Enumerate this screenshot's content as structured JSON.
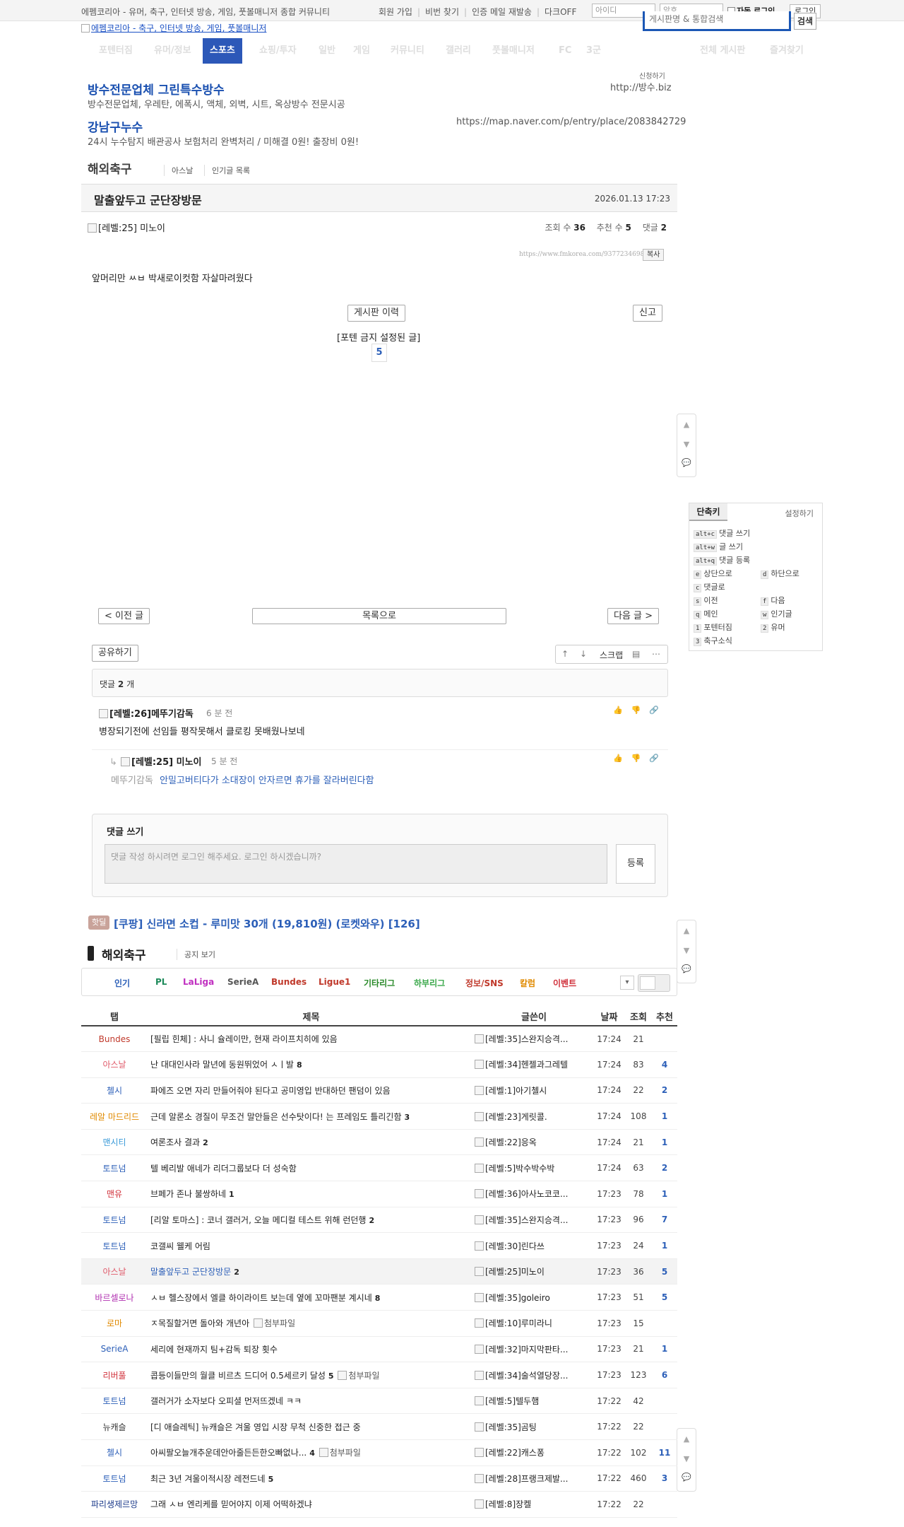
{
  "topbar": {
    "tagline": "에펨코리아 - 유머, 축구, 인터넷 방송, 게임, 풋볼매니저 종합 커뮤니티",
    "links": [
      "회원 가입",
      "비번 찾기",
      "인증 메일 재발송",
      "다크OFF"
    ],
    "id_placeholder": "아이디",
    "pw_placeholder": "암호",
    "autologin_label": "자동 로그인",
    "login_label": "로그인"
  },
  "header": {
    "logo_alt": "에펨코리아 - 축구, 인터넷 방송, 게임, 풋볼매니저",
    "search_placeholder": "게시판명 & 통합검색",
    "search_button": "검색"
  },
  "nav": {
    "items": [
      "포텐터짐",
      "유머/정보",
      "스포츠",
      "쇼핑/투자",
      "일반",
      "게임",
      "커뮤니티",
      "갤러리",
      "풋볼매니저",
      "FC",
      "3군",
      "전체 게시판",
      "즐겨찾기"
    ],
    "active_index": 2
  },
  "ads": {
    "apply": "신청하기",
    "items": [
      {
        "title": "방수전문업체 그린특수방수",
        "desc": "방수전문업체, 우레탄, 에폭시, 액체, 외벽, 시트, 옥상방수 전문시공",
        "url": "http://방수.biz"
      },
      {
        "title": "강남구누수",
        "desc": "24시 누수탐지 배관공사 보험처리 완벽처리 / 미해결 0원! 출장비 0원!",
        "url": "https://map.naver.com/p/entry/place/2083842729"
      }
    ]
  },
  "board": {
    "title": "해외축구",
    "sublinks": [
      "아스날",
      "인기글 목록"
    ]
  },
  "post": {
    "title": "말출앞두고 군단장방문",
    "date": "2026.01.13 17:23",
    "author_level": "[레벨:25]",
    "author": "미노이",
    "views_label": "조회 수",
    "views": "36",
    "recs_label": "추천 수",
    "recs": "5",
    "comments_label": "댓글",
    "comments": "2",
    "url": "https://www.fmkorea.com/9377234698",
    "copy_label": "복사",
    "body": "앞머리만 ㅆㅂ 박새로이컷함 자살마려웠다",
    "history_btn": "게시판 이력",
    "report_btn": "신고",
    "ban_notice": "[포텐 금지 설정된 글]",
    "vote_count": "5",
    "prev_btn": "< 이전 글",
    "list_btn": "목록으로",
    "next_btn": "다음 글 >",
    "share_btn": "공유하기",
    "scrap_label": "스크랩"
  },
  "shortcuts": {
    "tab": "단축키",
    "settings": "설정하기",
    "rows": [
      {
        "key": "alt+c",
        "label": "댓글 쓰기"
      },
      {
        "key": "alt+w",
        "label": "글 쓰기"
      },
      {
        "key": "alt+q",
        "label": "댓글 등록"
      }
    ],
    "grid": [
      {
        "key": "e",
        "label": "상단으로"
      },
      {
        "key": "d",
        "label": "하단으로"
      },
      {
        "key": "c",
        "label": "댓글로"
      },
      {
        "key": "s",
        "label": "이전"
      },
      {
        "key": "f",
        "label": "다음"
      },
      {
        "key": "q",
        "label": "메인"
      },
      {
        "key": "w",
        "label": "인기글"
      },
      {
        "key": "1",
        "label": "포텐터짐"
      },
      {
        "key": "2",
        "label": "유머"
      },
      {
        "key": "3",
        "label": "축구소식"
      }
    ]
  },
  "comments": {
    "header_prefix": "댓글",
    "count": "2",
    "header_suffix": "개",
    "items": [
      {
        "level": "[레벨:26]",
        "author": "메뚜기감독",
        "time": "6 분 전",
        "body": "병장되기전에 선임들 평작못해서 클로킹 못배웠나보네"
      },
      {
        "level": "[레벨:25]",
        "author": "미노이",
        "time": "5 분 전",
        "reply_to": "메뚜기감독",
        "body": "안밀고버티다가 소대장이 안자르면 휴가를 잘라버린다함"
      }
    ],
    "write_title": "댓글 쓰기",
    "write_placeholder": "댓글 작성 하시려면 로그인 해주세요. 로그인 하시겠습니까?",
    "submit": "등록"
  },
  "hot": {
    "badge": "핫딜",
    "text": "[쿠팡] 신라면 소컵 - 루미맛 30개 (19,810원) (로켓와우) [126]"
  },
  "list": {
    "title": "해외축구",
    "notice": "공지 보기",
    "categories": [
      {
        "label": "인기",
        "color": "#2c5fb8"
      },
      {
        "label": "PL",
        "color": "#1d8a5a"
      },
      {
        "label": "LaLiga",
        "color": "#c02fc0"
      },
      {
        "label": "SerieA",
        "color": "#555555"
      },
      {
        "label": "Bundes",
        "color": "#c0392b"
      },
      {
        "label": "Ligue1",
        "color": "#c0392b"
      },
      {
        "label": "기타리그",
        "color": "#2a8a2a"
      },
      {
        "label": "하부리그",
        "color": "#3aa84a"
      },
      {
        "label": "정보/SNS",
        "color": "#c0392b"
      },
      {
        "label": "칼럼",
        "color": "#e08a00"
      },
      {
        "label": "이벤트",
        "color": "#d0303a"
      }
    ],
    "headers": [
      "탭",
      "제목",
      "글쓴이",
      "날짜",
      "조회",
      "추천"
    ],
    "attach_label": "첨부파일",
    "rows": [
      {
        "cat": "Bundes",
        "cat_color": "#c0392b",
        "title": "[필립 힌체] : 사니 슐레이만, 현재 라이프치히에 있음",
        "cc": "",
        "attach": false,
        "level": "[레벨:35]",
        "author": "스완지승격...",
        "date": "17:24",
        "views": "21",
        "rec": ""
      },
      {
        "cat": "아스날",
        "cat_color": "#e05a6a",
        "title": "난 대대인사라 말년에 동원뛰었어 ㅅㅣ발",
        "cc": "8",
        "attach": false,
        "level": "[레벨:34]",
        "author": "헨젤과그레텔",
        "date": "17:24",
        "views": "83",
        "rec": "4"
      },
      {
        "cat": "첼시",
        "cat_color": "#2c5fb8",
        "title": "파에즈 오면 자리 만들어줘야 된다고 공미영입 반대하던 팬덤이 있음",
        "cc": "",
        "attach": false,
        "level": "[레벨:1]",
        "author": "아기첼시",
        "date": "17:24",
        "views": "22",
        "rec": "2"
      },
      {
        "cat": "레알 마드리드",
        "cat_color": "#e08a00",
        "title": "근데 알론소 경질이 무조건 말안들은 선수탓이다! 는 프레임도 틀리긴함",
        "cc": "3",
        "attach": false,
        "level": "[레벨:23]",
        "author": "게릿콜.",
        "date": "17:24",
        "views": "108",
        "rec": "1"
      },
      {
        "cat": "맨시티",
        "cat_color": "#3a9ad8",
        "title": "여론조사 결과",
        "cc": "2",
        "attach": false,
        "level": "[레벨:22]",
        "author": "응옥",
        "date": "17:24",
        "views": "21",
        "rec": "1"
      },
      {
        "cat": "토트넘",
        "cat_color": "#2c5fb8",
        "title": "텔 베리발 애네가 리더그룹보다 더 성숙함",
        "cc": "",
        "attach": false,
        "level": "[레벨:5]",
        "author": "박수박수박",
        "date": "17:24",
        "views": "63",
        "rec": "2"
      },
      {
        "cat": "맨유",
        "cat_color": "#d0303a",
        "title": "브페가 존나 불쌍하네",
        "cc": "1",
        "attach": false,
        "level": "[레벨:36]",
        "author": "아사노코코...",
        "date": "17:23",
        "views": "78",
        "rec": "1"
      },
      {
        "cat": "토트넘",
        "cat_color": "#2c5fb8",
        "title": "[리알 토마스] : 코너 갤러거, 오늘 메디컬 테스트 위해 런던행",
        "cc": "2",
        "attach": false,
        "level": "[레벨:35]",
        "author": "스완지승격...",
        "date": "17:23",
        "views": "96",
        "rec": "7"
      },
      {
        "cat": "토트넘",
        "cat_color": "#2c5fb8",
        "title": "코갤씨 웰케 어림",
        "cc": "",
        "attach": false,
        "level": "[레벨:30]",
        "author": "린다쓰",
        "date": "17:23",
        "views": "24",
        "rec": "1"
      },
      {
        "cat": "아스날",
        "cat_color": "#e05a6a",
        "title": "말출앞두고 군단장방문",
        "cc": "2",
        "attach": false,
        "level": "[레벨:25]",
        "author": "미노이",
        "date": "17:23",
        "views": "36",
        "rec": "5",
        "current": true
      },
      {
        "cat": "바르셀로나",
        "cat_color": "#b02fb0",
        "title": "ㅅㅂ 헬스장에서 엘클 하이라이트 보는데 옆에 꼬마팬분 계시네",
        "cc": "8",
        "attach": false,
        "level": "[레벨:35]",
        "author": "goleiro",
        "date": "17:23",
        "views": "51",
        "rec": "5"
      },
      {
        "cat": "로마",
        "cat_color": "#e08a00",
        "title": "ㅈ목질할거면 돌아와 개년아",
        "cc": "",
        "attach": true,
        "level": "[레벨:10]",
        "author": "루미라니",
        "date": "17:23",
        "views": "15",
        "rec": ""
      },
      {
        "cat": "SerieA",
        "cat_color": "#2c5fb8",
        "title": "세리에 현재까지 팀+감독 퇴장 횟수",
        "cc": "",
        "attach": false,
        "level": "[레벨:32]",
        "author": "마지막판타...",
        "date": "17:23",
        "views": "21",
        "rec": "1"
      },
      {
        "cat": "리버풀",
        "cat_color": "#d0303a",
        "title": "콥등이들만의 월클 비르츠 드디어 0.5세르키 달성",
        "cc": "5",
        "attach": true,
        "level": "[레벨:34]",
        "author": "술석열당장...",
        "date": "17:23",
        "views": "123",
        "rec": "6"
      },
      {
        "cat": "토트넘",
        "cat_color": "#2c5fb8",
        "title": "갤러거가 소자보다 오피셜 먼저뜨겠네 ㅋㅋ",
        "cc": "",
        "attach": false,
        "level": "[레벨:5]",
        "author": "텔두햄",
        "date": "17:22",
        "views": "42",
        "rec": ""
      },
      {
        "cat": "뉴캐슬",
        "cat_color": "#333333",
        "title": "[디 애슬레틱] 뉴캐슬은 겨울 영입 시장 무척 신중한 접근 중",
        "cc": "",
        "attach": false,
        "level": "[레벨:35]",
        "author": "곰팅",
        "date": "17:22",
        "views": "22",
        "rec": ""
      },
      {
        "cat": "첼시",
        "cat_color": "#2c5fb8",
        "title": "아씨팔오늘개추운데안아줄든든한오빠없나...",
        "cc": "4",
        "attach": true,
        "level": "[레벨:22]",
        "author": "캐스퐁",
        "date": "17:22",
        "views": "102",
        "rec": "11"
      },
      {
        "cat": "토트넘",
        "cat_color": "#2c5fb8",
        "title": "최근 3년 겨울이적시장 레전드네",
        "cc": "5",
        "attach": false,
        "level": "[레벨:28]",
        "author": "프랭크제발...",
        "date": "17:22",
        "views": "460",
        "rec": "3"
      },
      {
        "cat": "파리생제르망",
        "cat_color": "#1b3a8a",
        "title": "그래 ㅅㅂ 엔리케를 믿어야지 이제 어떡하겠냐",
        "cc": "",
        "attach": false,
        "level": "[레벨:8]",
        "author": "장켈",
        "date": "17:22",
        "views": "22",
        "rec": ""
      }
    ]
  }
}
